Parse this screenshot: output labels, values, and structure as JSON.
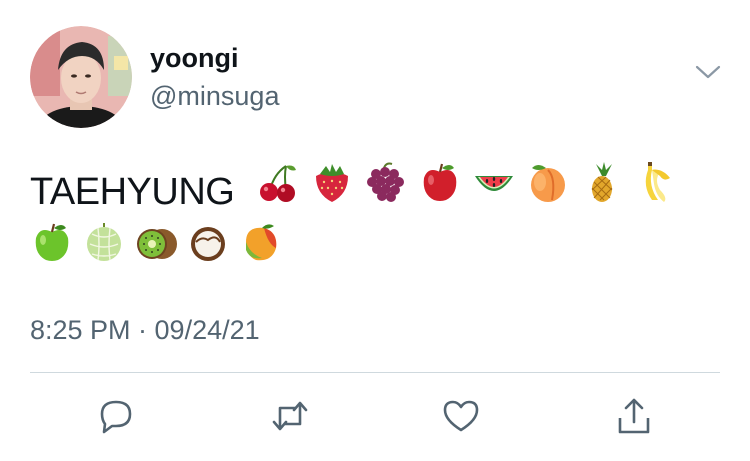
{
  "tweet": {
    "display_name": "yoongi",
    "handle": "@minsuga",
    "text_word": "TAEHYUNG",
    "emojis_row1": [
      "cherries",
      "strawberry",
      "grapes",
      "red-apple",
      "watermelon",
      "peach",
      "pineapple",
      "banana"
    ],
    "emojis_row2": [
      "green-apple",
      "melon",
      "kiwi",
      "coconut",
      "mango"
    ],
    "timestamp": "8:25 PM · 09/24/21"
  },
  "icons": {
    "caret": "chevron-down-icon",
    "actions": [
      "reply-icon",
      "retweet-icon",
      "like-icon",
      "share-icon"
    ]
  },
  "colors": {
    "text": "#0f1419",
    "secondary": "#536471",
    "divider": "#cfd9de",
    "icon": "#536471"
  }
}
